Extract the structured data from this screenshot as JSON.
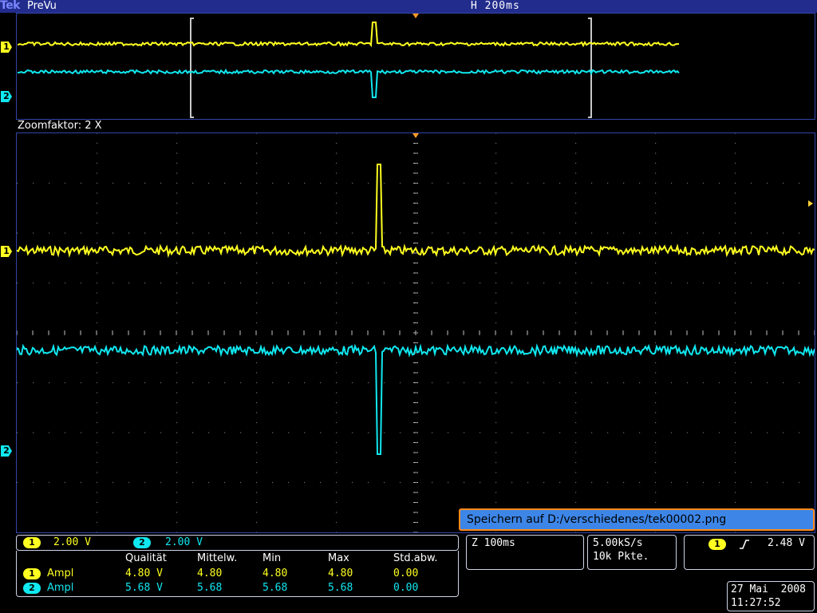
{
  "header": {
    "brand": "Tek",
    "mode": "PreVu",
    "horizontal_scale": "H 200ms"
  },
  "zoom": {
    "label": "Zoomfaktor: 2 X"
  },
  "channels": {
    "ch1": {
      "number": "1",
      "color": "#ffff20"
    },
    "ch2": {
      "number": "2",
      "color": "#10e8f0"
    }
  },
  "vertical": {
    "ch1_scale": "2.00 V",
    "ch2_scale": "2.00 V"
  },
  "measurements": {
    "headers": [
      "Qualität",
      "Mittelw.",
      "Min",
      "Max",
      "Std.abw."
    ],
    "rows": [
      {
        "channel": "1",
        "name": "Ampl",
        "quality": "4.80 V",
        "mean": "4.80",
        "min": "4.80",
        "max": "4.80",
        "std": "0.00"
      },
      {
        "channel": "2",
        "name": "Ampl",
        "quality": "5.68 V",
        "mean": "5.68",
        "min": "5.68",
        "max": "5.68",
        "std": "0.00"
      }
    ]
  },
  "zoom_timebase": "Z 100ms",
  "acquisition": {
    "sample_rate": "5.00kS/s",
    "record_length": "10k Pkte."
  },
  "trigger": {
    "source": "1",
    "slope_icon": "rising-edge-icon",
    "level": "2.48 V"
  },
  "save_message": "Speichern auf D:/verschiedenes/tek00002.png",
  "datetime": {
    "date": "27 Mai  2008",
    "time": "11:27:52"
  }
}
